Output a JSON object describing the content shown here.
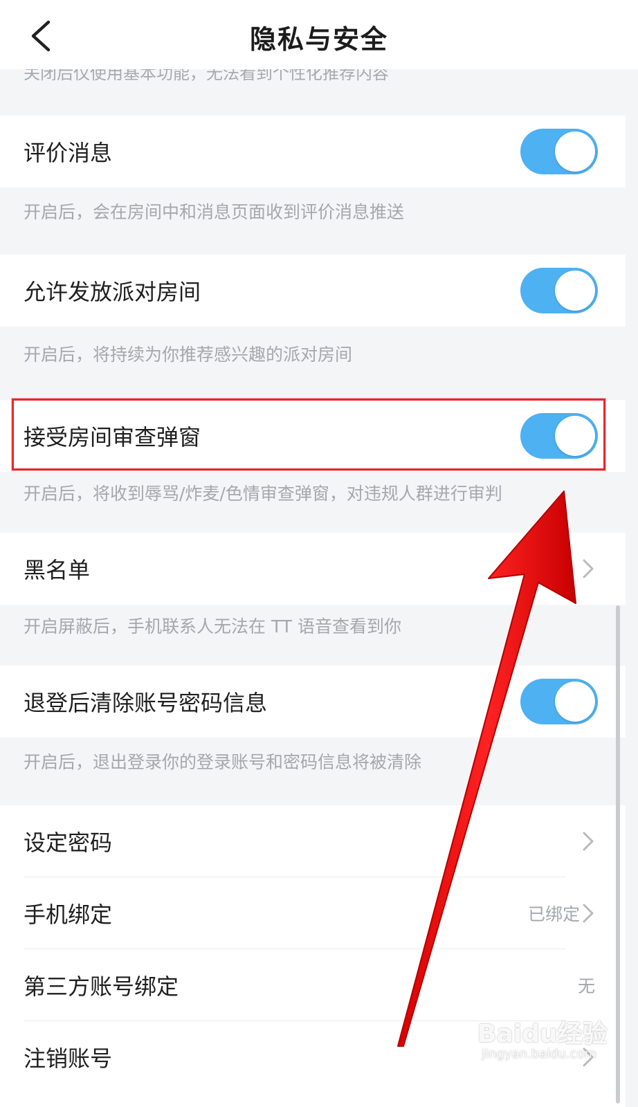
{
  "header": {
    "title": "隐私与安全",
    "back_icon": "chevron-left-icon"
  },
  "top_description": "关闭后仅使用基本功能，无法看到个性化推荐内容",
  "settings": [
    {
      "label": "评价消息",
      "control": "toggle",
      "enabled": true,
      "description": "开启后，会在房间中和消息页面收到评价消息推送"
    },
    {
      "label": "允许发放派对房间",
      "control": "toggle",
      "enabled": true,
      "description": "开启后，将持续为你推荐感兴趣的派对房间"
    },
    {
      "label": "接受房间审查弹窗",
      "control": "toggle",
      "enabled": true,
      "description": "开启后，将收到辱骂/炸麦/色情审查弹窗，对违规人群进行审判"
    },
    {
      "label": "黑名单",
      "control": "chevron",
      "description": "开启屏蔽后，手机联系人无法在 TT 语音查看到你"
    },
    {
      "label": "退登后清除账号密码信息",
      "control": "toggle",
      "enabled": true,
      "description": "开启后，退出登录你的登录账号和密码信息将被清除"
    }
  ],
  "account_items": [
    {
      "label": "设定密码",
      "value": "",
      "chevron": true
    },
    {
      "label": "手机绑定",
      "value": "已绑定",
      "chevron": true
    },
    {
      "label": "第三方账号绑定",
      "value": "无",
      "chevron": false
    },
    {
      "label": "注销账号",
      "value": "",
      "chevron": true
    }
  ],
  "colors": {
    "toggle_on": "#4db1f2",
    "highlight": "#e8262a",
    "arrow": "#ff1a1a",
    "background": "#f4f5f7"
  },
  "watermark": {
    "logo": "Baidu经验",
    "url": "jingyan.baidu.com"
  }
}
